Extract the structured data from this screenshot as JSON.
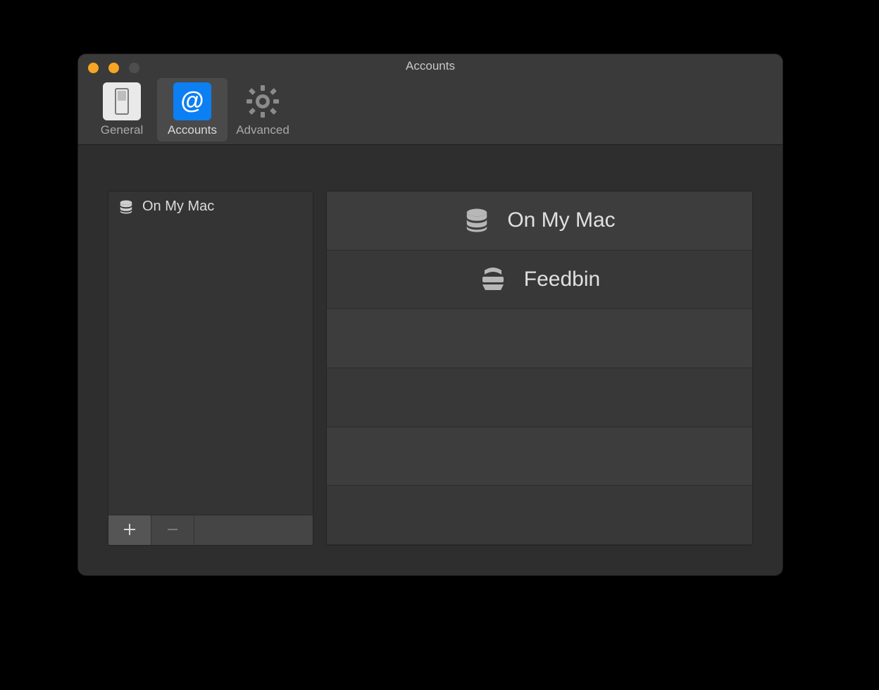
{
  "window": {
    "title": "Accounts"
  },
  "toolbar": {
    "tabs": [
      {
        "label": "General",
        "icon": "switch",
        "active": false
      },
      {
        "label": "Accounts",
        "icon": "at",
        "active": true
      },
      {
        "label": "Advanced",
        "icon": "gear",
        "active": false
      }
    ]
  },
  "sidebar": {
    "accounts": [
      {
        "label": "On My Mac",
        "icon": "database"
      }
    ]
  },
  "account_types": {
    "rows": [
      {
        "label": "On My Mac",
        "icon": "database"
      },
      {
        "label": "Feedbin",
        "icon": "feedbin"
      },
      {
        "label": "",
        "icon": ""
      },
      {
        "label": "",
        "icon": ""
      },
      {
        "label": "",
        "icon": ""
      },
      {
        "label": "",
        "icon": ""
      }
    ]
  }
}
